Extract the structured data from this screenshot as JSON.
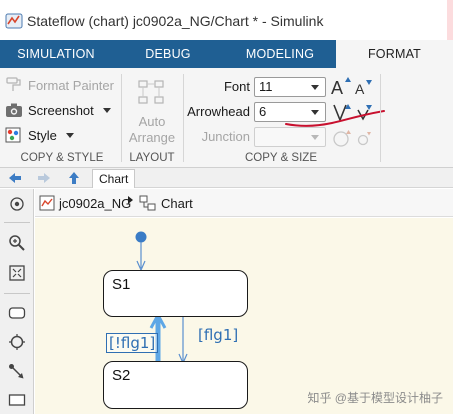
{
  "window": {
    "title": "Stateflow (chart) jc0902a_NG/Chart * - Simulink"
  },
  "ribbon_tabs": [
    {
      "label": "SIMULATION",
      "active": false
    },
    {
      "label": "DEBUG",
      "active": false
    },
    {
      "label": "MODELING",
      "active": false
    },
    {
      "label": "FORMAT",
      "active": true
    }
  ],
  "copy_style_group": {
    "format_painter": "Format Painter",
    "screenshot": "Screenshot",
    "style": "Style",
    "label": "COPY & STYLE"
  },
  "layout_group": {
    "auto_arrange_line1": "Auto",
    "auto_arrange_line2": "Arrange",
    "label": "LAYOUT"
  },
  "copy_size_group": {
    "font_label": "Font",
    "font_value": "11",
    "arrowhead_label": "Arrowhead",
    "arrowhead_value": "6",
    "junction_label": "Junction",
    "label": "COPY & SIZE"
  },
  "nav": {
    "tab_label": "Chart"
  },
  "breadcrumb": {
    "model": "jc0902a_NG",
    "chart": "Chart"
  },
  "diagram": {
    "states": [
      {
        "name": "S1"
      },
      {
        "name": "S2"
      }
    ],
    "transitions": [
      {
        "label": "[!flg1]"
      },
      {
        "label": "[flg1]"
      }
    ]
  },
  "watermark": "知乎 @基于模型设计柚子",
  "colors": {
    "tabbar": "#1f5f93",
    "canvas": "#fbf8e8",
    "transition": "#2f6fb3",
    "annotation_stroke": "#c8102e"
  }
}
